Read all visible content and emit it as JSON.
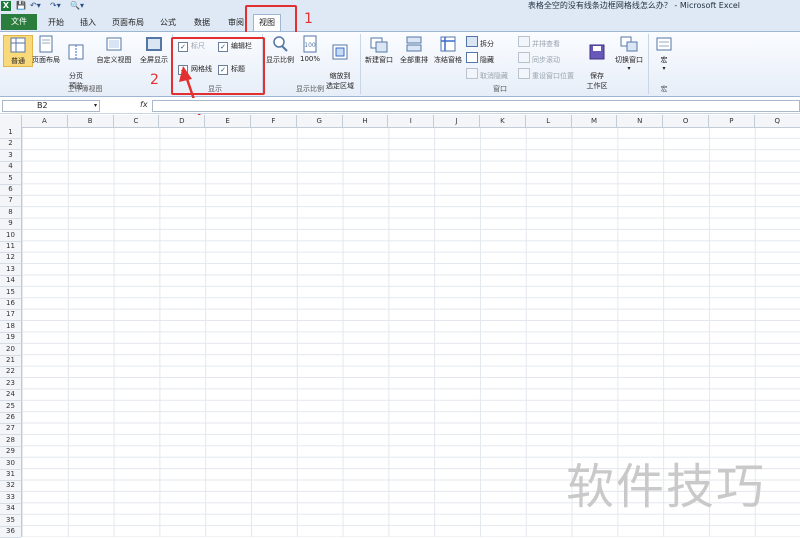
{
  "window": {
    "title": "表格全空的没有线条边框网格线怎么办？ - Microsoft Excel",
    "app_icon": "X"
  },
  "tabs": [
    {
      "label": "文件"
    },
    {
      "label": "开始"
    },
    {
      "label": "插入"
    },
    {
      "label": "页面布局"
    },
    {
      "label": "公式"
    },
    {
      "label": "数据"
    },
    {
      "label": "审阅"
    },
    {
      "label": "视图"
    }
  ],
  "annotations": {
    "step1": "1",
    "step2": "2"
  },
  "ribbon": {
    "workbook_views": {
      "label": "工作簿视图",
      "normal": "普通",
      "page_layout": "页面布局",
      "page_break": "分页\n预览",
      "custom": "自定义视图",
      "fullscreen": "全屏显示"
    },
    "show": {
      "label": "显示",
      "ruler": "标尺",
      "formula_bar": "编辑栏",
      "gridlines": "网格线",
      "headings": "标题"
    },
    "zoom": {
      "label": "显示比例",
      "zoom": "显示比例",
      "hundred": "100%",
      "zoom_selection": "缩放到\n选定区域"
    },
    "window": {
      "label": "窗口",
      "new_window": "新建窗口",
      "arrange_all": "全部重排",
      "freeze": "冻结窗格",
      "split": "拆分",
      "hide": "隐藏",
      "unhide": "取消隐藏",
      "side_by_side": "并排查看",
      "sync_scroll": "同步滚动",
      "reset_pos": "重设窗口位置",
      "save_workspace": "保存\n工作区",
      "switch_windows": "切换窗口"
    },
    "macros": {
      "label": "宏",
      "macros": "宏"
    }
  },
  "formula_bar": {
    "name_box": "B2",
    "fx": "fx",
    "value": ""
  },
  "columns": [
    "A",
    "B",
    "C",
    "D",
    "E",
    "F",
    "G",
    "H",
    "I",
    "J",
    "K",
    "L",
    "M",
    "N",
    "O",
    "P",
    "Q"
  ],
  "rows": [
    "1",
    "2",
    "3",
    "4",
    "5",
    "6",
    "7",
    "8",
    "9",
    "10",
    "11",
    "12",
    "13",
    "14",
    "15",
    "16",
    "17",
    "18",
    "19",
    "20",
    "21",
    "22",
    "23",
    "24",
    "25",
    "26",
    "27",
    "28",
    "29",
    "30",
    "31",
    "32",
    "33",
    "34",
    "35",
    "36"
  ],
  "watermark": "软件技巧",
  "colors": {
    "accent_red": "#e23030",
    "file_tab": "#2a7d3d"
  }
}
